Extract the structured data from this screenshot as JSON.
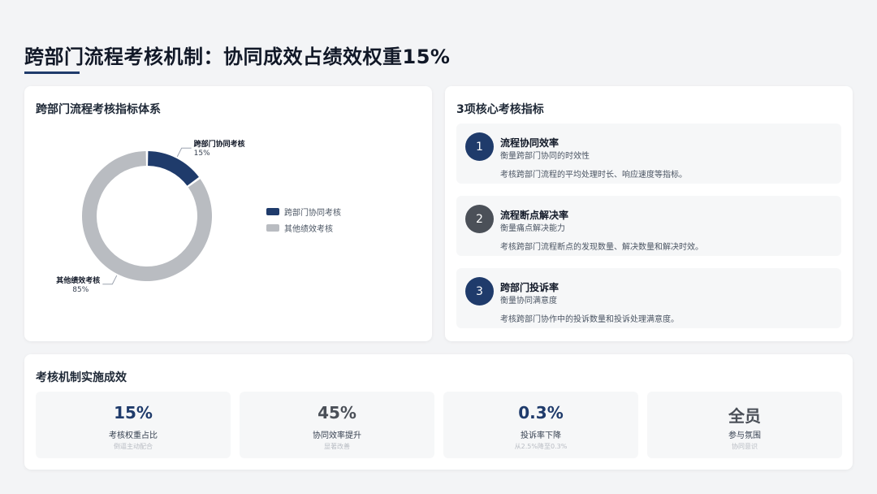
{
  "header": {
    "title": "跨部门流程考核机制：协同成效占绩效权重15%"
  },
  "left_card": {
    "title": "跨部门流程考核指标体系"
  },
  "chart_data": {
    "type": "pie",
    "categories": [
      "跨部门协同考核",
      "其他绩效考核"
    ],
    "values": [
      15,
      85
    ],
    "value_labels": [
      "15%",
      "85%"
    ],
    "colors": [
      "#1f3b6b",
      "#b9bcc1"
    ],
    "legend_position": "right"
  },
  "right_card": {
    "title": "3项核心考核指标",
    "metrics": [
      {
        "num": "1",
        "name": "流程协同效率",
        "sub": "衡量跨部门协同的时效性",
        "desc": "考核跨部门流程的平均处理时长、响应速度等指标。",
        "color": "#1f3b6b"
      },
      {
        "num": "2",
        "name": "流程断点解决率",
        "sub": "衡量痛点解决能力",
        "desc": "考核跨部门流程断点的发现数量、解决数量和解决时效。",
        "color": "#4b5058"
      },
      {
        "num": "3",
        "name": "跨部门投诉率",
        "sub": "衡量协同满意度",
        "desc": "考核跨部门协作中的投诉数量和投诉处理满意度。",
        "color": "#1f3b6b"
      }
    ]
  },
  "bottom_card": {
    "title": "考核机制实施成效",
    "stats": [
      {
        "value": "15%",
        "label": "考核权重占比",
        "note": "倒逼主动配合",
        "color": "#1f3b6b"
      },
      {
        "value": "45%",
        "label": "协同效率提升",
        "note": "显著改善",
        "color": "#4b5058"
      },
      {
        "value": "0.3%",
        "label": "投诉率下降",
        "note": "从2.5%降至0.3%",
        "color": "#1f3b6b"
      },
      {
        "value": "全员",
        "label": "参与氛围",
        "note": "协同意识",
        "color": "#4b5058"
      }
    ]
  }
}
